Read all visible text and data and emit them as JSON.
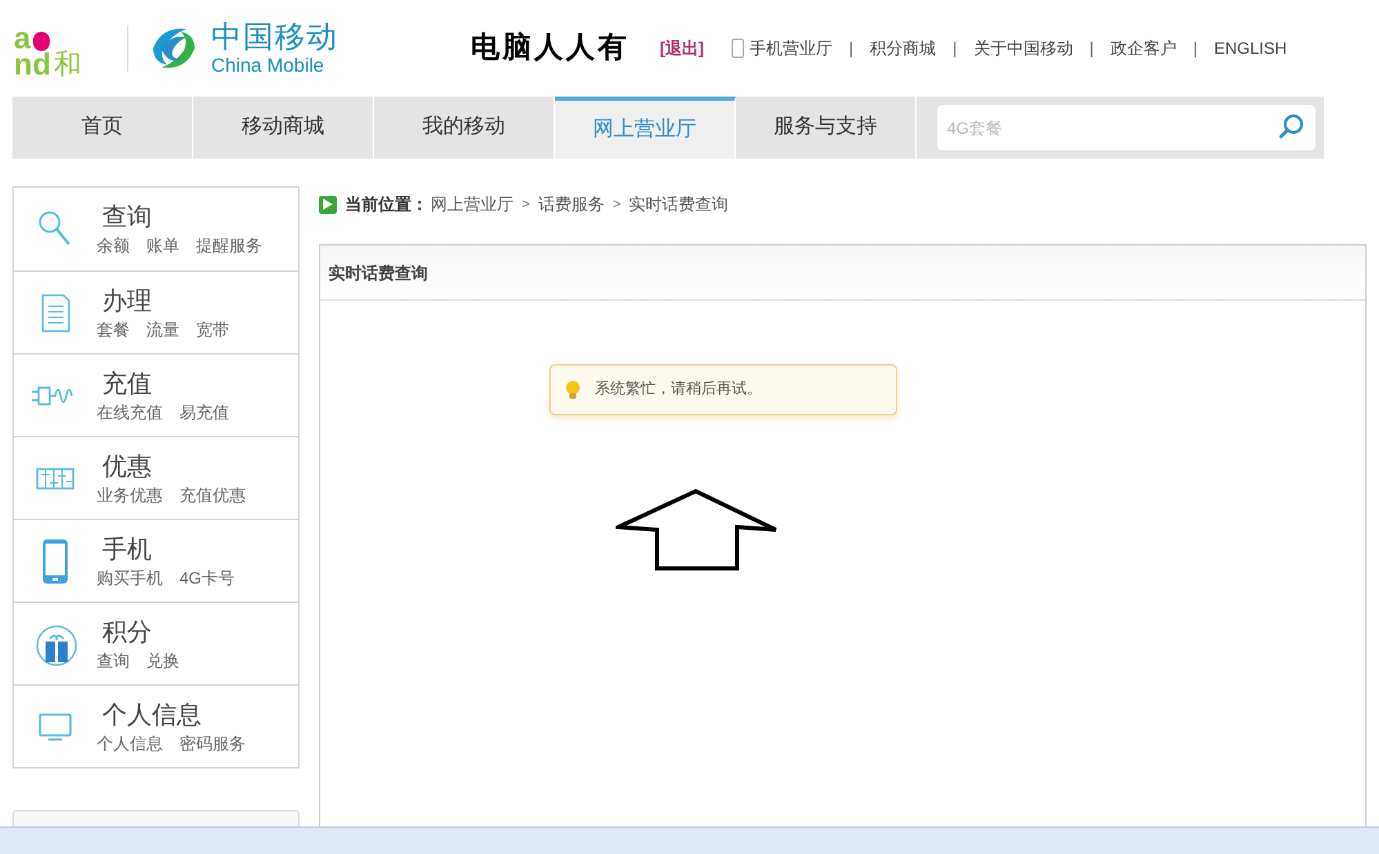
{
  "header": {
    "brand_logo": {
      "left": "a",
      "bottom": "nd",
      "char": "和"
    },
    "company_logo": {
      "name_cn": "中国移动",
      "name_en": "China Mobile"
    },
    "overlay_caption": "电脑人人有",
    "logout": "[退出]",
    "links": [
      {
        "label": "手机营业厅",
        "kind": "phone"
      },
      {
        "label": "积分商城",
        "kind": "plain"
      },
      {
        "label": "关于中国移动",
        "kind": "plain"
      },
      {
        "label": "政企客户",
        "kind": "plain"
      },
      {
        "label": "ENGLISH",
        "kind": "plain"
      }
    ],
    "separator": "|"
  },
  "nav": {
    "tabs": [
      {
        "label": "首页",
        "selected": false
      },
      {
        "label": "移动商城",
        "selected": false
      },
      {
        "label": "我的移动",
        "selected": false
      },
      {
        "label": "网上营业厅",
        "selected": true
      },
      {
        "label": "服务与支持",
        "selected": false
      }
    ],
    "search": {
      "placeholder": "4G套餐"
    }
  },
  "sidebar": {
    "items": [
      {
        "title": "查询",
        "kind": "search",
        "links": [
          "余额",
          "账单",
          "提醒服务"
        ]
      },
      {
        "title": "办理",
        "kind": "document",
        "links": [
          "套餐",
          "流量",
          "宽带"
        ]
      },
      {
        "title": "充值",
        "kind": "plug",
        "links": [
          "在线充值",
          "易充值"
        ]
      },
      {
        "title": "优惠",
        "kind": "abacus",
        "links": [
          "业务优惠",
          "充值优惠"
        ]
      },
      {
        "title": "手机",
        "kind": "phone",
        "links": [
          "购买手机",
          "4G卡号"
        ]
      },
      {
        "title": "积分",
        "kind": "gift",
        "links": [
          "查询",
          "兑换"
        ]
      },
      {
        "title": "个人信息",
        "kind": "monitor",
        "links": [
          "个人信息",
          "密码服务"
        ]
      }
    ]
  },
  "breadcrumb": {
    "label": "当前位置：",
    "path": [
      "网上营业厅",
      "话费服务",
      "实时话费查询"
    ],
    "separator": ">"
  },
  "panel": {
    "title": "实时话费查询",
    "notice": "系统繁忙，请稍后再试。"
  }
}
